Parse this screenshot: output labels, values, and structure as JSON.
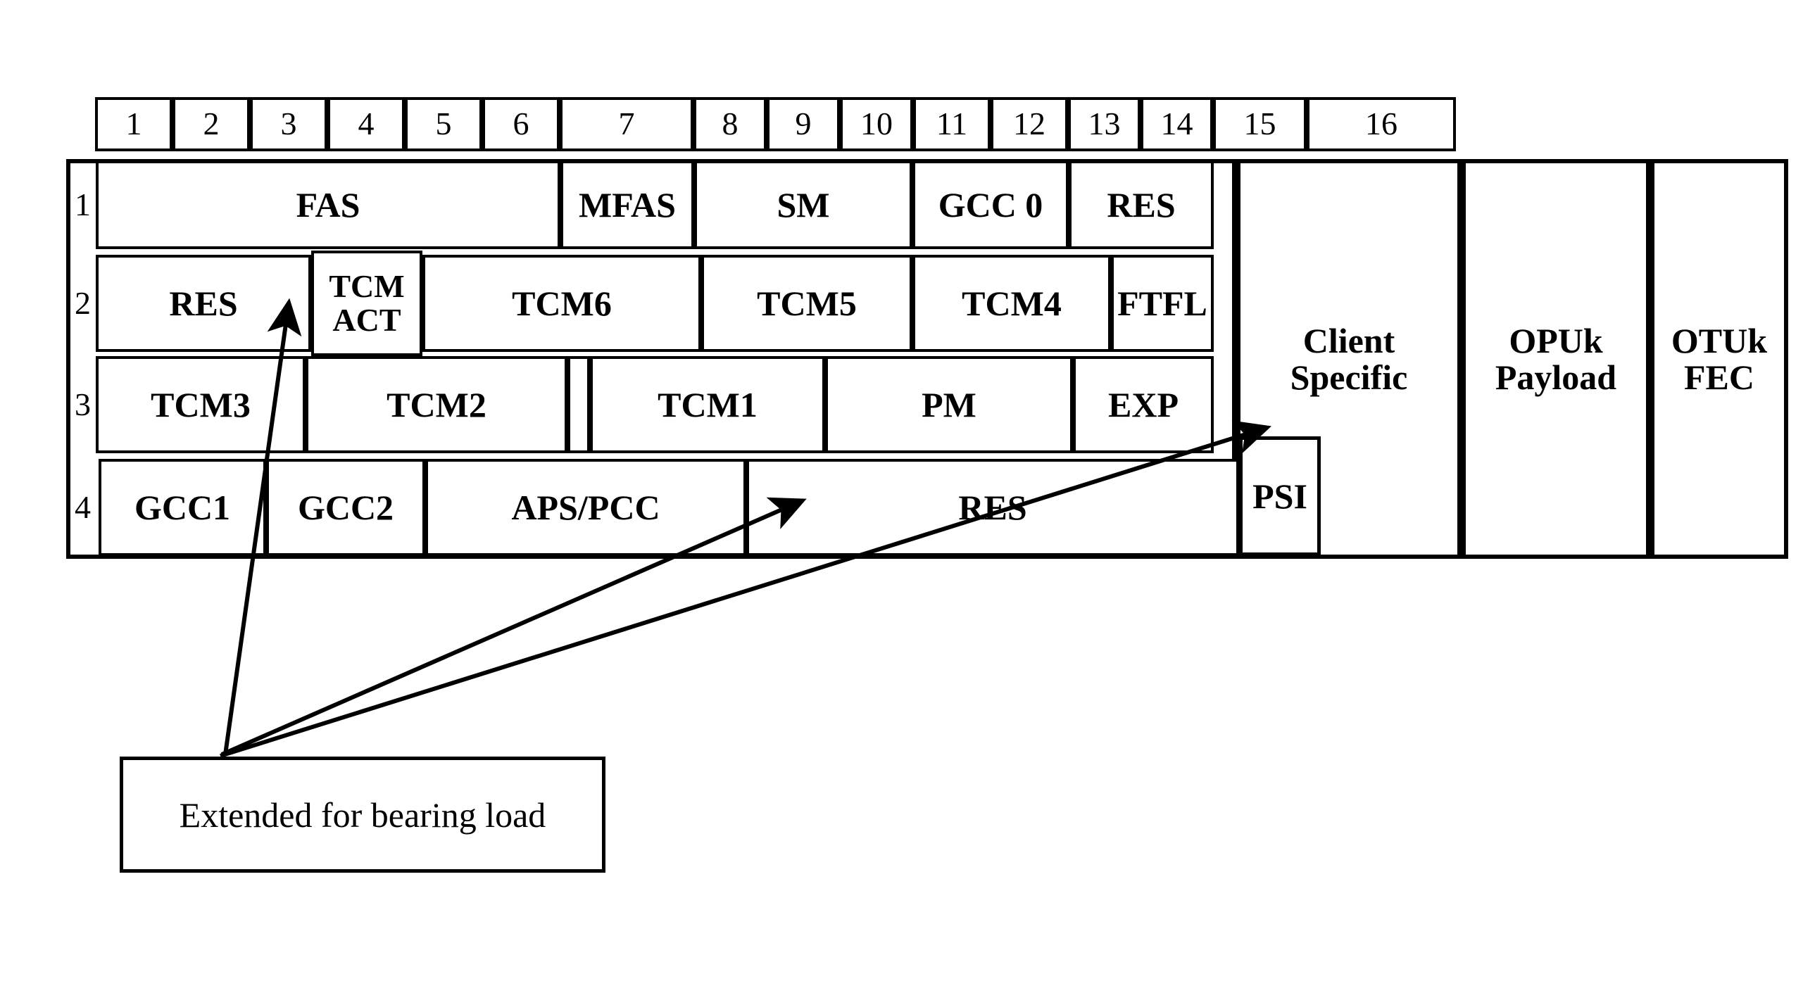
{
  "diagram": {
    "title": "OTUk frame structure with extended overhead",
    "column_headers": [
      "1",
      "2",
      "3",
      "4",
      "5",
      "6",
      "7",
      "8",
      "9",
      "10",
      "11",
      "12",
      "13",
      "14",
      "15",
      "16"
    ],
    "row_labels": [
      "1",
      "2",
      "3",
      "4"
    ],
    "rows": [
      {
        "label": "1",
        "cells": [
          {
            "text": "FAS"
          },
          {
            "text": "MFAS"
          },
          {
            "text": "SM"
          },
          {
            "text": "GCC 0"
          },
          {
            "text": "RES"
          }
        ]
      },
      {
        "label": "2",
        "cells": [
          {
            "text": "RES"
          },
          {
            "text": "TCM\nACT"
          },
          {
            "text": "TCM6"
          },
          {
            "text": "TCM5"
          },
          {
            "text": "TCM4"
          },
          {
            "text": "FTFL"
          }
        ]
      },
      {
        "label": "3",
        "cells": [
          {
            "text": "TCM3"
          },
          {
            "text": "TCM2"
          },
          {
            "text": ""
          },
          {
            "text": "TCM1"
          },
          {
            "text": "PM"
          },
          {
            "text": "EXP"
          }
        ]
      },
      {
        "label": "4",
        "cells": [
          {
            "text": "GCC1"
          },
          {
            "text": "GCC2"
          },
          {
            "text": "APS/PCC"
          },
          {
            "text": "RES"
          },
          {
            "text": "PSI"
          }
        ]
      }
    ],
    "side_blocks": [
      {
        "text": "Client\nSpecific"
      },
      {
        "text": "OPUk\nPayload"
      },
      {
        "text": "OTUk\nFEC"
      }
    ],
    "callout": {
      "text": "Extended for bearing load"
    },
    "colors": {
      "line": "#000000",
      "background": "#ffffff",
      "text": "#000000"
    }
  }
}
